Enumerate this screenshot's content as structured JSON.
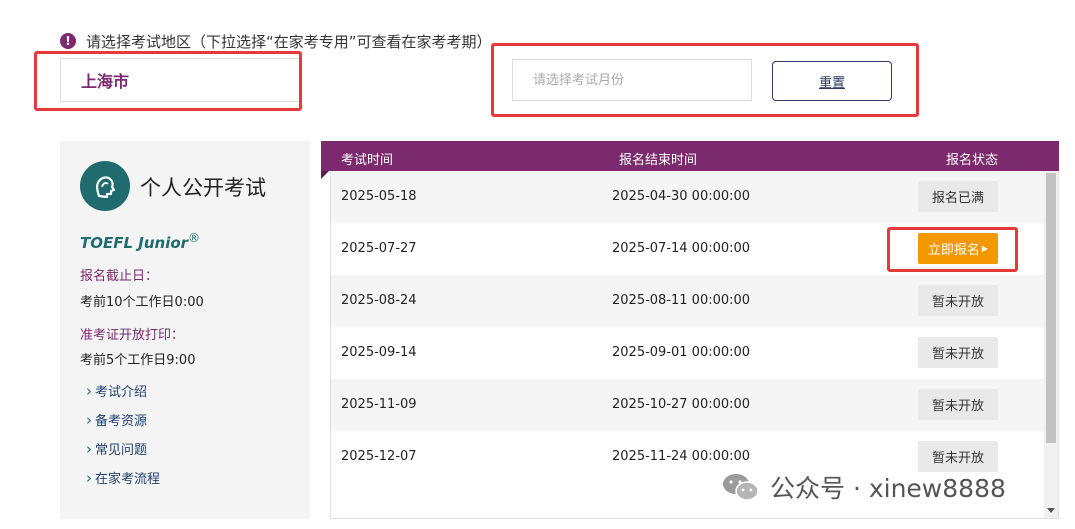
{
  "filter": {
    "notice_icon": "!",
    "notice_text": "请选择考试地区（下拉选择“在家考专用”可查看在家考考期）",
    "region_value": "上海市",
    "month_placeholder": "请选择考试月份",
    "reset_label": "重置"
  },
  "side": {
    "logo_icon": "head-profile-icon",
    "title": "个人公开考试",
    "brand": "TOEFL Junior",
    "brand_mark": "®",
    "deadline_label": "报名截止日：",
    "deadline_value": "考前10个工作日0:00",
    "admit_label": "准考证开放打印：",
    "admit_value": "考前5个工作日9:00",
    "links": [
      {
        "label": "考试介绍"
      },
      {
        "label": "备考资源"
      },
      {
        "label": "常见问题"
      },
      {
        "label": "在家考流程"
      }
    ]
  },
  "table": {
    "headers": {
      "date": "考试时间",
      "end": "报名结束时间",
      "status": "报名状态"
    },
    "rows": [
      {
        "date": "2025-05-18",
        "end": "2025-04-30 00:00:00",
        "status": "报名已满"
      },
      {
        "date": "2025-07-27",
        "end": "2025-07-14 00:00:00",
        "status": "立即报名"
      },
      {
        "date": "2025-08-24",
        "end": "2025-08-11 00:00:00",
        "status": "暂未开放"
      },
      {
        "date": "2025-09-14",
        "end": "2025-09-01 00:00:00",
        "status": "暂未开放"
      },
      {
        "date": "2025-11-09",
        "end": "2025-10-27 00:00:00",
        "status": "暂未开放"
      },
      {
        "date": "2025-12-07",
        "end": "2025-11-24 00:00:00",
        "status": "暂未开放"
      }
    ]
  },
  "watermark": {
    "icon": "wechat-icon",
    "text": "公众号 · xinew8888"
  },
  "colors": {
    "brand_purple": "#7c2a6e",
    "teal": "#1f6b6d",
    "register_orange": "#f39800",
    "highlight_red": "#e63a3a"
  }
}
